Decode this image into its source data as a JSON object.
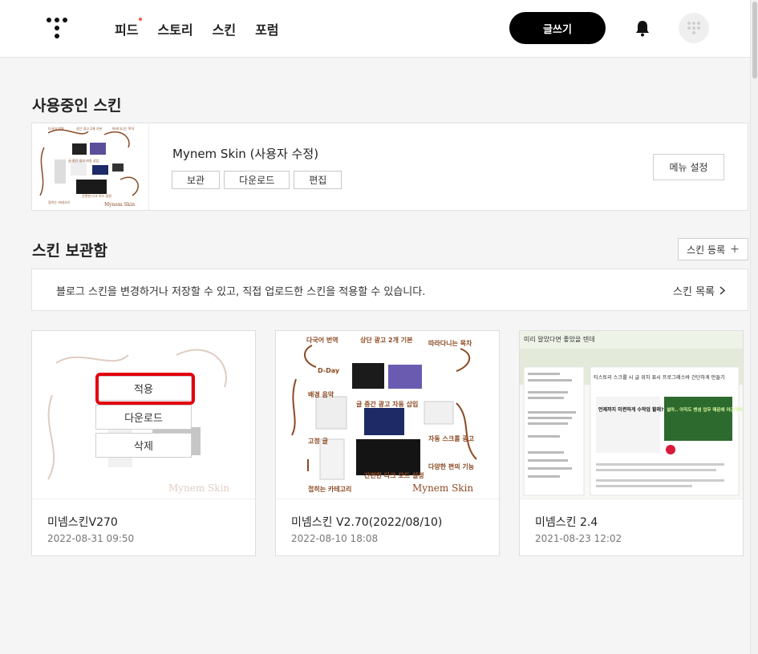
{
  "nav": {
    "items": [
      "피드",
      "스토리",
      "스킨",
      "포럼"
    ],
    "write_label": "글쓰기"
  },
  "current": {
    "title": "사용중인 스킨",
    "skin_name": "Mynem Skin (사용자 수정)",
    "buttons": [
      "보관",
      "다운로드",
      "편집"
    ],
    "menu_label": "메뉴 설정",
    "thumb_brand": "Mynem Skin"
  },
  "storage": {
    "title": "스킨 보관함",
    "register_label": "스킨 등록",
    "info_text": "블로그 스킨을 변경하거나 저장할 수 있고, 직접 업로드한 스킨을 적용할 수 있습니다.",
    "list_link": "스킨 목록"
  },
  "overlay": {
    "apply": "적용",
    "download": "다운로드",
    "delete": "삭제"
  },
  "cards": [
    {
      "name": "미넴스킨V270",
      "date": "2022-08-31 09:50"
    },
    {
      "name": "미넴스킨 V2.70(2022/08/10)",
      "date": "2022-08-10 18:08"
    },
    {
      "name": "미넴스킨 2.4",
      "date": "2021-08-23 12:02"
    }
  ],
  "thumb_labels": {
    "brand": "Mynem Skin",
    "t1": "다국어 번역",
    "t2": "상단 광고 2개 기본",
    "t3": "따라다니는 목차",
    "t4": "D-Day",
    "t5": "배경 음악",
    "t6": "글 중간 광고 자동 삽입",
    "t7": "고정 글",
    "t8": "자동 스크롤 광고",
    "t9": "다양한 편의 기능",
    "t10": "간편한 다크 모드 설정",
    "t11": "접히는 카테고리"
  },
  "third_thumb": {
    "header": "미리 알았다면 좋았을 텐데",
    "post_title": "티스토리 스크롤 시 글 위치 표시 프로그레스바 간단하게 만들기",
    "ad_text": "언제까지 미련하게 수작업 할래?",
    "ad_side": "설마.. 아직도 밴섬 업무 때문에 야근하세요?"
  },
  "colors": {
    "accent_red": "#e3000f",
    "brown": "#8b4a24"
  }
}
